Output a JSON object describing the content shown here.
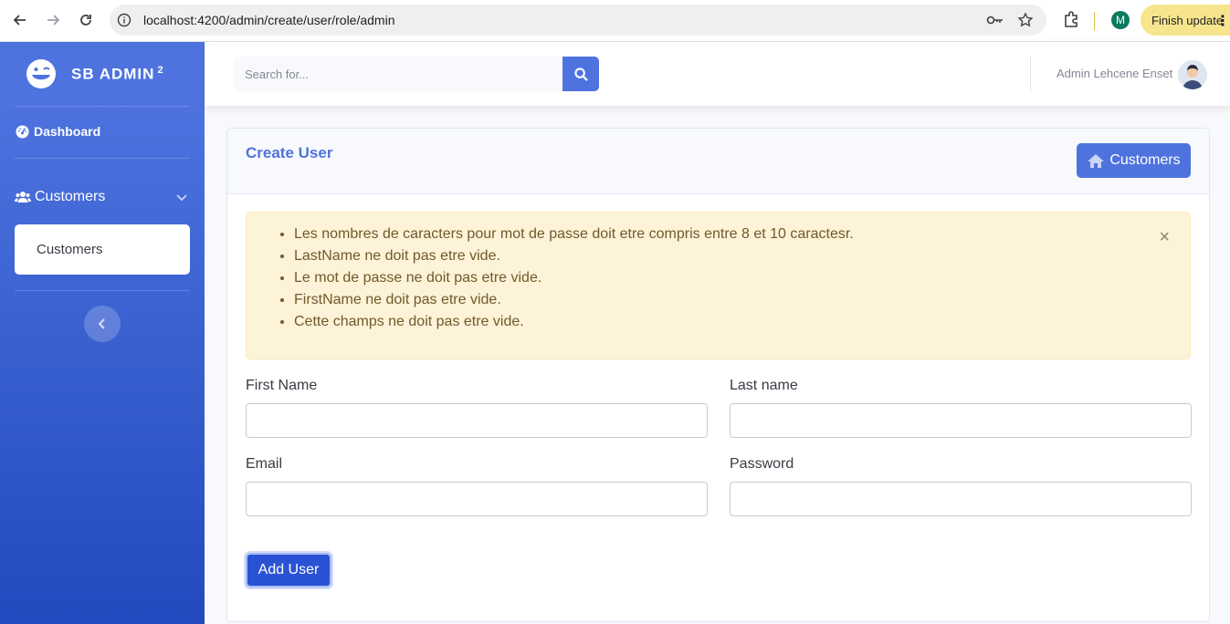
{
  "browser": {
    "url": "localhost:4200/admin/create/user/role/admin",
    "profile_initial": "M",
    "update_label": "Finish update"
  },
  "sidebar": {
    "brand": "SB ADMIN",
    "brand_sup": "2",
    "dashboard_label": "Dashboard",
    "customers_label": "Customers",
    "sub_items": [
      "Customers"
    ]
  },
  "topbar": {
    "search_placeholder": "Search for...",
    "user_name": "Admin Lehcene Enset"
  },
  "card": {
    "title": "Create User",
    "customers_button": "Customers"
  },
  "alert": {
    "messages": [
      "Les nombres de caracters pour mot de passe doit etre compris entre 8 et 10 caractesr.",
      "LastName ne doit pas etre vide.",
      "Le mot de passe ne doit pas etre vide.",
      "FirstName ne doit pas etre vide.",
      "Cette champs ne doit pas etre vide."
    ],
    "close_glyph": "×"
  },
  "form": {
    "first_name_label": "First Name",
    "last_name_label": "Last name",
    "email_label": "Email",
    "password_label": "Password",
    "first_name_value": "",
    "last_name_value": "",
    "email_value": "",
    "password_value": "",
    "submit_label": "Add User"
  },
  "colors": {
    "primary": "#4e73df",
    "warning_bg": "#fdf3d8"
  }
}
